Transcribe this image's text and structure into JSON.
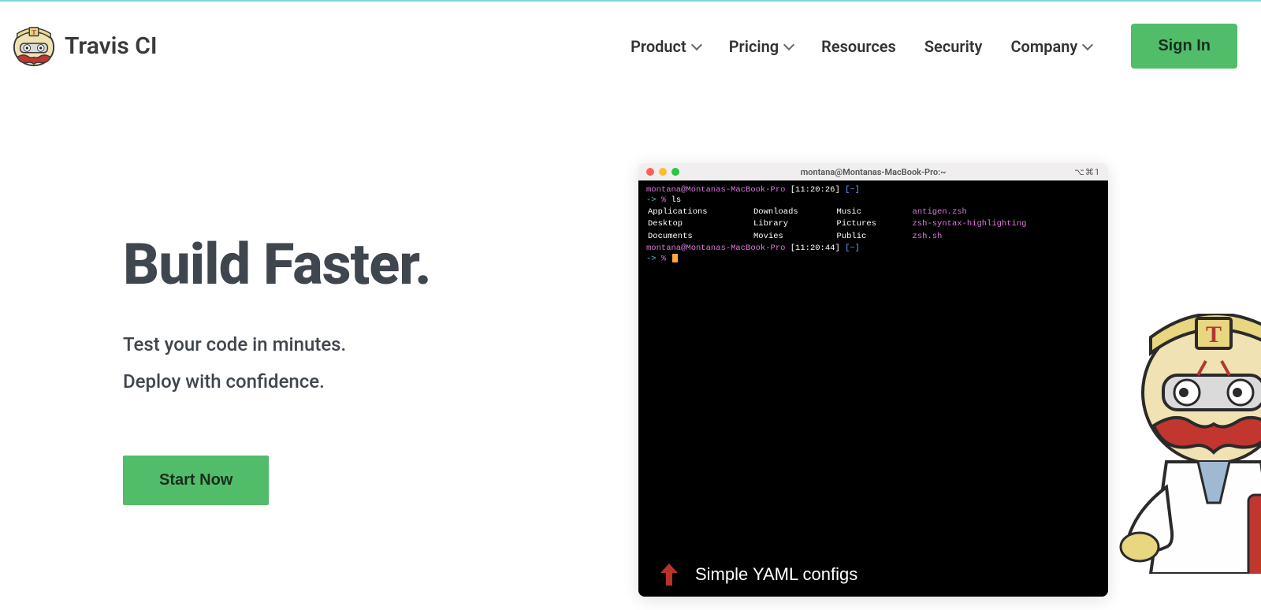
{
  "brand": "Travis CI",
  "nav": {
    "product": "Product",
    "pricing": "Pricing",
    "resources": "Resources",
    "security": "Security",
    "company": "Company",
    "signin": "Sign In"
  },
  "hero": {
    "title": "Build Faster.",
    "sub1": "Test your code in minutes.",
    "sub2": "Deploy with confidence.",
    "cta": "Start Now"
  },
  "terminal": {
    "title": "montana@Montanas-MacBook-Pro:~",
    "icons": "⌥⌘1",
    "prompt1_user": "montana@Montanas-MacBook-Pro",
    "prompt1_time": "[11:20:26]",
    "prompt1_path": "[~]",
    "line2_arrow": "->",
    "line2_pct": "%",
    "line2_cmd": "ls",
    "ls": {
      "r1c1": "Applications",
      "r1c2": "Downloads",
      "r1c3": "Music",
      "r1c4": "antigen.zsh",
      "r2c1": "Desktop",
      "r2c2": "Library",
      "r2c3": "Pictures",
      "r2c4": "zsh-syntax-highlighting",
      "r3c1": "Documents",
      "r3c2": "Movies",
      "r3c3": "Public",
      "r3c4": "zsh.sh"
    },
    "prompt2_user": "montana@Montanas-MacBook-Pro",
    "prompt2_time": "[11:20:44]",
    "prompt2_path": "[~]",
    "line_last_arrow": "->",
    "line_last_pct": "%",
    "caption": "Simple YAML configs"
  }
}
